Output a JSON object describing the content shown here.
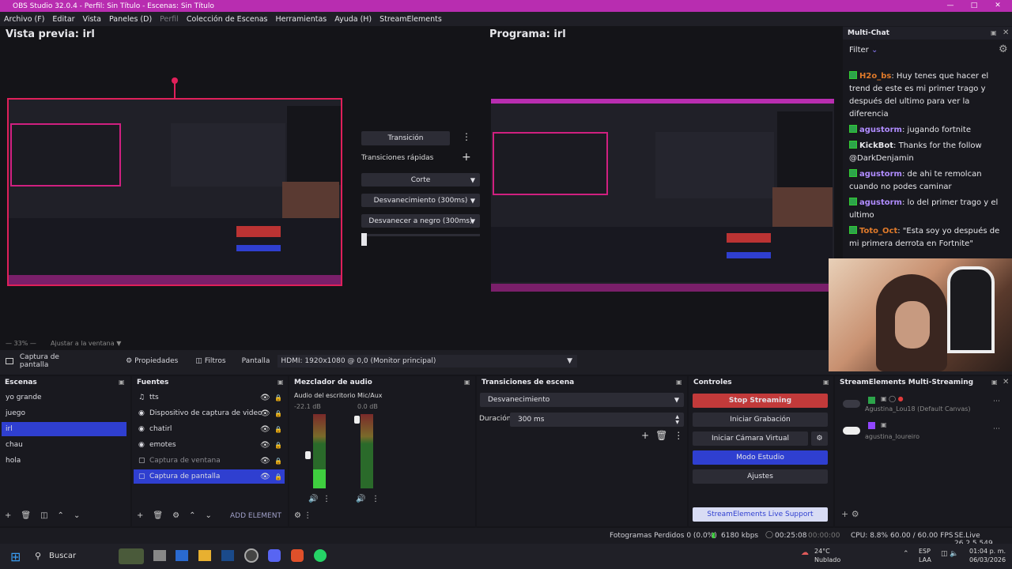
{
  "window": {
    "title": "OBS Studio 32.0.4 - Perfil: Sin Título - Escenas: Sin Título"
  },
  "menu": [
    "Archivo (F)",
    "Editar",
    "Vista",
    "Paneles (D)",
    "Perfil",
    "Colección de Escenas",
    "Herramientas",
    "Ayuda (H)",
    "StreamElements"
  ],
  "preview": {
    "title": "Vista previa: irl",
    "zoom": "33%",
    "fit_label": "Ajustar a la ventana"
  },
  "program": {
    "title": "Programa: irl"
  },
  "transition": {
    "button": "Transición",
    "quick_label": "Transiciones rápidas",
    "options": [
      "Corte",
      "Desvanecimiento (300ms)",
      "Desvanecer a negro (300ms)"
    ]
  },
  "chat": {
    "title": "Multi-Chat",
    "filter": "Filter",
    "messages": [
      {
        "user": "H2o_bs",
        "color": "#e07a2a",
        "text": "Huy tenes que hacer el trend de este es mi primer trago y después del ultimo para ver la diferencia"
      },
      {
        "user": "agustorm",
        "color": "#b08cff",
        "text": "jugando fortnite"
      },
      {
        "user": "KickBot",
        "color": "#e6e6ea",
        "text": "Thanks for the follow @DarkDenjamin"
      },
      {
        "user": "agustorm",
        "color": "#b08cff",
        "text": "de ahi te remolcan cuando no podes caminar"
      },
      {
        "user": "agustorm",
        "color": "#b08cff",
        "text": "lo del primer trago y el ultimo"
      },
      {
        "user": "Toto_Oct",
        "color": "#e07a2a",
        "text": "\"Esta soy yo después de mi primera derrota en Fortnite\""
      }
    ]
  },
  "context_bar": {
    "source": "Captura de pantalla",
    "props": "Propiedades",
    "filters": "Filtros",
    "display_label": "Pantalla",
    "display_value": "HDMI: 1920x1080 @ 0,0 (Monitor principal)"
  },
  "scenes": {
    "title": "Escenas",
    "items": [
      "yo grande",
      "juego",
      "irl",
      "chau",
      "hola"
    ],
    "selected": "irl"
  },
  "sources": {
    "title": "Fuentes",
    "items": [
      "tts",
      "Dispositivo de captura de video",
      "chatirl",
      "emotes",
      "Captura de ventana",
      "Captura de pantalla"
    ],
    "selected": "Captura de pantalla",
    "add_element": "ADD ELEMENT"
  },
  "mixer": {
    "title": "Mezclador de audio",
    "channels": [
      {
        "name": "Audio del escritorio",
        "level": "-22.1 dB"
      },
      {
        "name": "Mic/Aux",
        "level": "0.0 dB"
      }
    ]
  },
  "scene_transitions": {
    "title": "Transiciones de escena",
    "selected": "Desvanecimiento",
    "duration_label": "Duración",
    "duration_value": "300 ms"
  },
  "controls": {
    "title": "Controles",
    "stop_streaming": "Stop Streaming",
    "start_recording": "Iniciar Grabación",
    "virtual_cam": "Iniciar Cámara Virtual",
    "studio_mode": "Modo Estudio",
    "settings": "Ajustes",
    "support": "StreamElements Live Support"
  },
  "multistream": {
    "title": "StreamElements Multi-Streaming",
    "accounts": [
      "Agustina_Lou18 (Default Canvas)",
      "agustina_loureiro"
    ]
  },
  "status": {
    "dropped": "Fotogramas Perdidos 0 (0.0%)",
    "bitrate": "6180 kbps",
    "rec_time": "00:00:00",
    "live_time": "00:25:08",
    "cpu": "CPU: 8.8%",
    "fps": "60.00 / 60.00 FPS",
    "version": "SE.Live 26.2.5.549"
  },
  "taskbar": {
    "search": "Buscar",
    "weather_temp": "24°C",
    "weather_desc": "Nublado",
    "lang1": "ESP",
    "lang2": "LAA",
    "time": "01:04 p. m.",
    "date": "06/03/2026"
  },
  "colors": {
    "accent": "#2f3fd0",
    "stop": "#c23a3a",
    "title": "#b82db0"
  }
}
